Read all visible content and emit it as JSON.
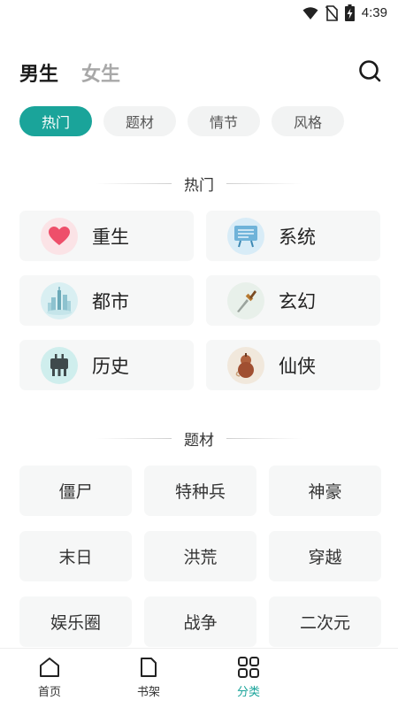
{
  "status_bar": {
    "time": "4:39",
    "icons": [
      "wifi-icon",
      "no-sim-icon",
      "battery-charging-icon"
    ]
  },
  "header": {
    "tabs": [
      {
        "label": "男生",
        "active": true
      },
      {
        "label": "女生",
        "active": false
      }
    ],
    "search_icon": "search-icon"
  },
  "filters": [
    {
      "label": "热门",
      "active": true
    },
    {
      "label": "题材",
      "active": false
    },
    {
      "label": "情节",
      "active": false
    },
    {
      "label": "风格",
      "active": false
    }
  ],
  "hot_section": {
    "title": "热门",
    "items": [
      {
        "label": "重生",
        "icon": "heart-icon"
      },
      {
        "label": "系统",
        "icon": "screen-icon"
      },
      {
        "label": "都市",
        "icon": "city-icon"
      },
      {
        "label": "玄幻",
        "icon": "dagger-icon"
      },
      {
        "label": "历史",
        "icon": "bronze-vessel-icon"
      },
      {
        "label": "仙侠",
        "icon": "gourd-icon"
      }
    ]
  },
  "theme_section": {
    "title": "题材",
    "items": [
      {
        "label": "僵尸"
      },
      {
        "label": "特种兵"
      },
      {
        "label": "神豪"
      },
      {
        "label": "末日"
      },
      {
        "label": "洪荒"
      },
      {
        "label": "穿越"
      },
      {
        "label": "娱乐圈"
      },
      {
        "label": "战争"
      },
      {
        "label": "二次元"
      }
    ]
  },
  "bottom_nav": [
    {
      "label": "首页",
      "icon": "home-icon"
    },
    {
      "label": "书架",
      "icon": "bookshelf-icon"
    },
    {
      "label": "分类",
      "icon": "category-grid-icon",
      "active": true
    }
  ],
  "colors": {
    "accent": "#1aa49a",
    "card_bg": "#f6f7f7",
    "chip_bg": "#f2f3f3"
  }
}
